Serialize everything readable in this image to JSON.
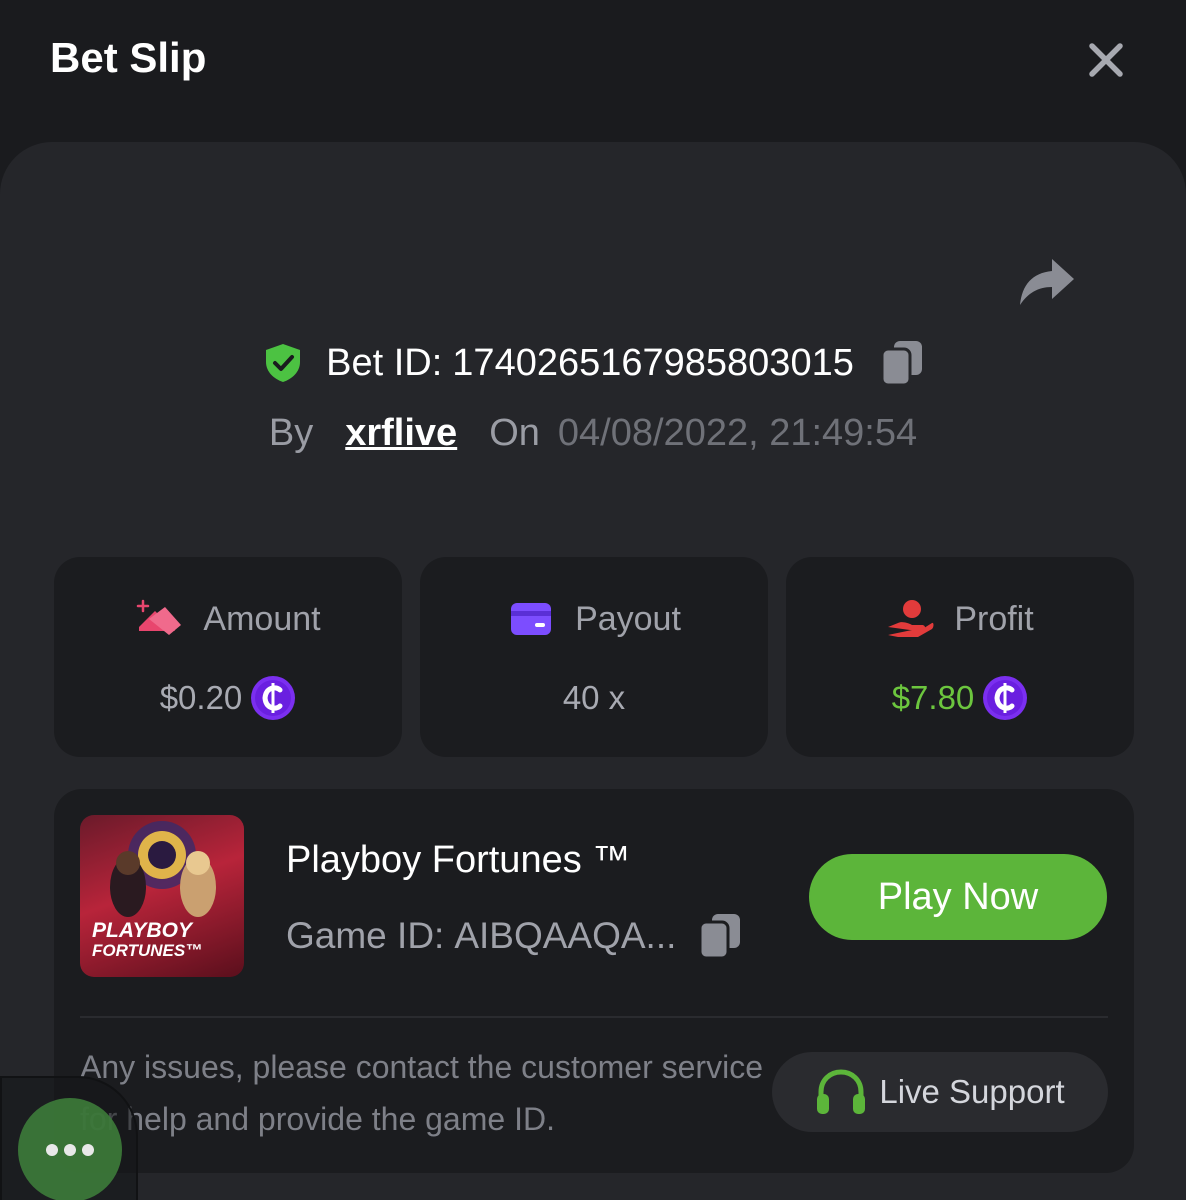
{
  "header": {
    "title": "Bet Slip"
  },
  "bet": {
    "id_label": "Bet ID:",
    "id": "1740265167985803015",
    "by_label": "By",
    "user": "xrflive",
    "on_label": "On",
    "datetime": "04/08/2022, 21:49:54"
  },
  "stats": {
    "amount": {
      "label": "Amount",
      "value": "$0.20",
      "icon": "money-stack-icon"
    },
    "payout": {
      "label": "Payout",
      "value": "40 x",
      "icon": "card-icon"
    },
    "profit": {
      "label": "Profit",
      "value": "$7.80",
      "icon": "hand-coin-icon"
    }
  },
  "game": {
    "thumb_title_1": "PLAYBOY",
    "thumb_title_2": "FORTUNES™",
    "name": "Playboy Fortunes ™",
    "id_label": "Game ID:",
    "id": "AIBQAAQA...",
    "play_label": "Play Now"
  },
  "support": {
    "notice": "Any issues, please contact the customer service for help and provide the game ID.",
    "button_label": "Live Support"
  },
  "colors": {
    "background": "#1a1b1e",
    "panel": "#25262a",
    "card": "#1b1c1f",
    "accent_green": "#5cb53a",
    "profit_green": "#6cc63e",
    "coin_purple": "#7b2ff0",
    "amount_pink": "#e8466e",
    "payout_purple": "#7c4dff",
    "profit_red": "#e23b3b",
    "shield_green": "#4cc242"
  }
}
